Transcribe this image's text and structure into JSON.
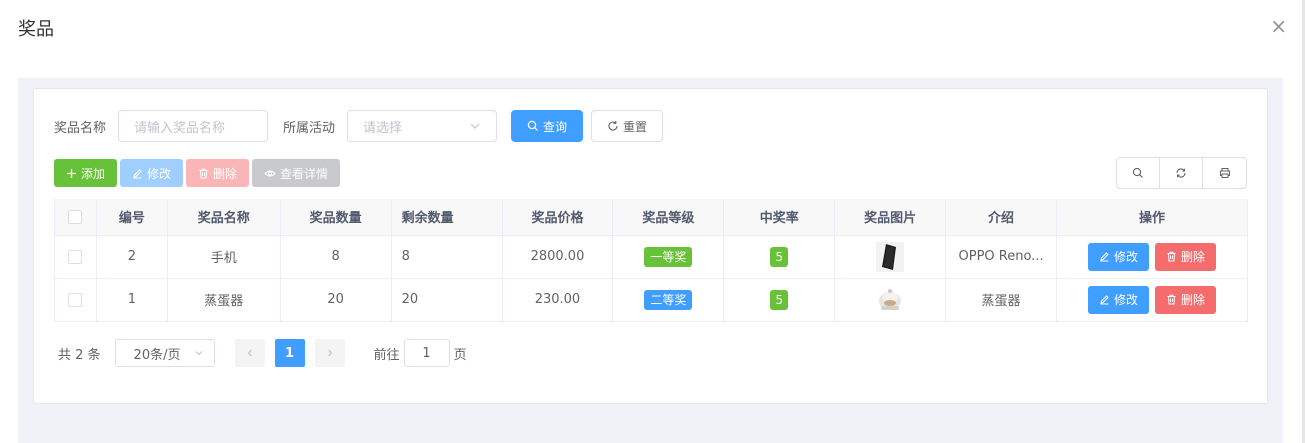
{
  "dialog": {
    "title": "奖品",
    "close_glyph": "×"
  },
  "search": {
    "name_label": "奖品名称",
    "name_placeholder": "请输入奖品名称",
    "activity_label": "所属活动",
    "activity_placeholder": "请选择",
    "query_label": "查询",
    "reset_label": "重置"
  },
  "toolbar": {
    "add_label": "添加",
    "edit_label": "修改",
    "delete_label": "删除",
    "detail_label": "查看详情"
  },
  "table": {
    "headers": [
      "编号",
      "奖品名称",
      "奖品数量",
      "剩余数量",
      "奖品价格",
      "奖品等级",
      "中奖率",
      "奖品图片",
      "介绍",
      "操作"
    ],
    "rows": [
      {
        "id": "2",
        "name": "手机",
        "quantity": "8",
        "remaining": "8",
        "price": "2800.00",
        "level": "一等奖",
        "rate": "5",
        "image": "phone-image",
        "intro": "OPPO Reno...",
        "edit": "修改",
        "delete": "删除"
      },
      {
        "id": "1",
        "name": "蒸蛋器",
        "quantity": "20",
        "remaining": "20",
        "price": "230.00",
        "level": "二等奖",
        "rate": "5",
        "image": "egg-cooker-image",
        "intro": "蒸蛋器",
        "edit": "修改",
        "delete": "删除"
      }
    ]
  },
  "pagination": {
    "total": "共 2 条",
    "page_size": "20条/页",
    "current_page": "1",
    "goto_label": "前往",
    "goto_value": "1",
    "page_suffix": "页"
  },
  "colors": {
    "primary": "#409eff",
    "success": "#67c23a",
    "danger": "#f56c6c"
  }
}
